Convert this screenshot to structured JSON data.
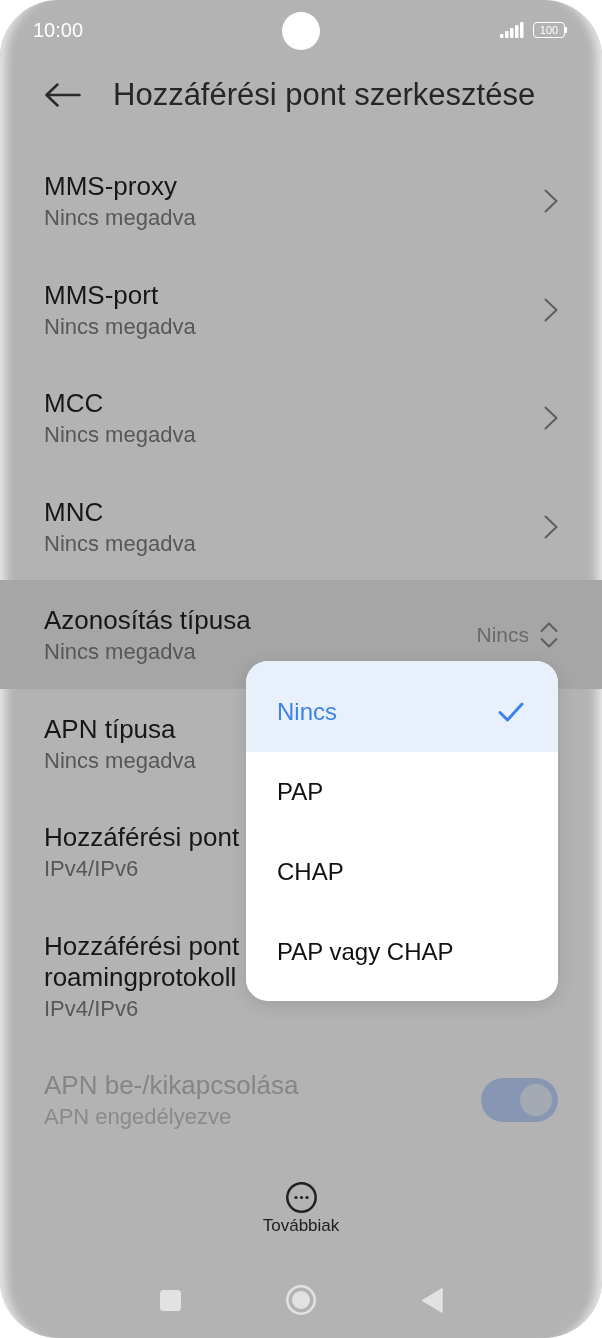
{
  "status_bar": {
    "time": "10:00",
    "battery": "100"
  },
  "header": {
    "title": "Hozzáférési pont szerkesztése"
  },
  "settings": [
    {
      "kind": "link",
      "title": "MMS-proxy",
      "subtitle": "Nincs megadva",
      "highlighted": false,
      "disabled": false
    },
    {
      "kind": "link",
      "title": "MMS-port",
      "subtitle": "Nincs megadva",
      "highlighted": false,
      "disabled": false
    },
    {
      "kind": "link",
      "title": "MCC",
      "subtitle": "Nincs megadva",
      "highlighted": false,
      "disabled": false
    },
    {
      "kind": "link",
      "title": "MNC",
      "subtitle": "Nincs megadva",
      "highlighted": false,
      "disabled": false
    },
    {
      "kind": "select",
      "title": "Azonosítás típusa",
      "subtitle": "Nincs megadva",
      "value": "Nincs",
      "highlighted": true,
      "disabled": false
    },
    {
      "kind": "plain",
      "title": "APN típusa",
      "subtitle": "Nincs megadva",
      "highlighted": false,
      "disabled": false
    },
    {
      "kind": "plain",
      "title": "Hozzáférési pont",
      "subtitle": "IPv4/IPv6",
      "highlighted": false,
      "disabled": false
    },
    {
      "kind": "plain",
      "title": "Hozzáférési pont\nroamingprotokoll",
      "subtitle": "IPv4/IPv6",
      "highlighted": false,
      "disabled": false
    },
    {
      "kind": "toggle",
      "title": "APN be-/kikapcsolása",
      "subtitle": "APN engedélyezve",
      "on": true,
      "highlighted": false,
      "disabled": true
    }
  ],
  "menu": {
    "options": [
      {
        "label": "Nincs",
        "selected": true
      },
      {
        "label": "PAP",
        "selected": false
      },
      {
        "label": "CHAP",
        "selected": false
      },
      {
        "label": "PAP vagy CHAP",
        "selected": false
      }
    ]
  },
  "more": {
    "label": "Továbbiak"
  }
}
